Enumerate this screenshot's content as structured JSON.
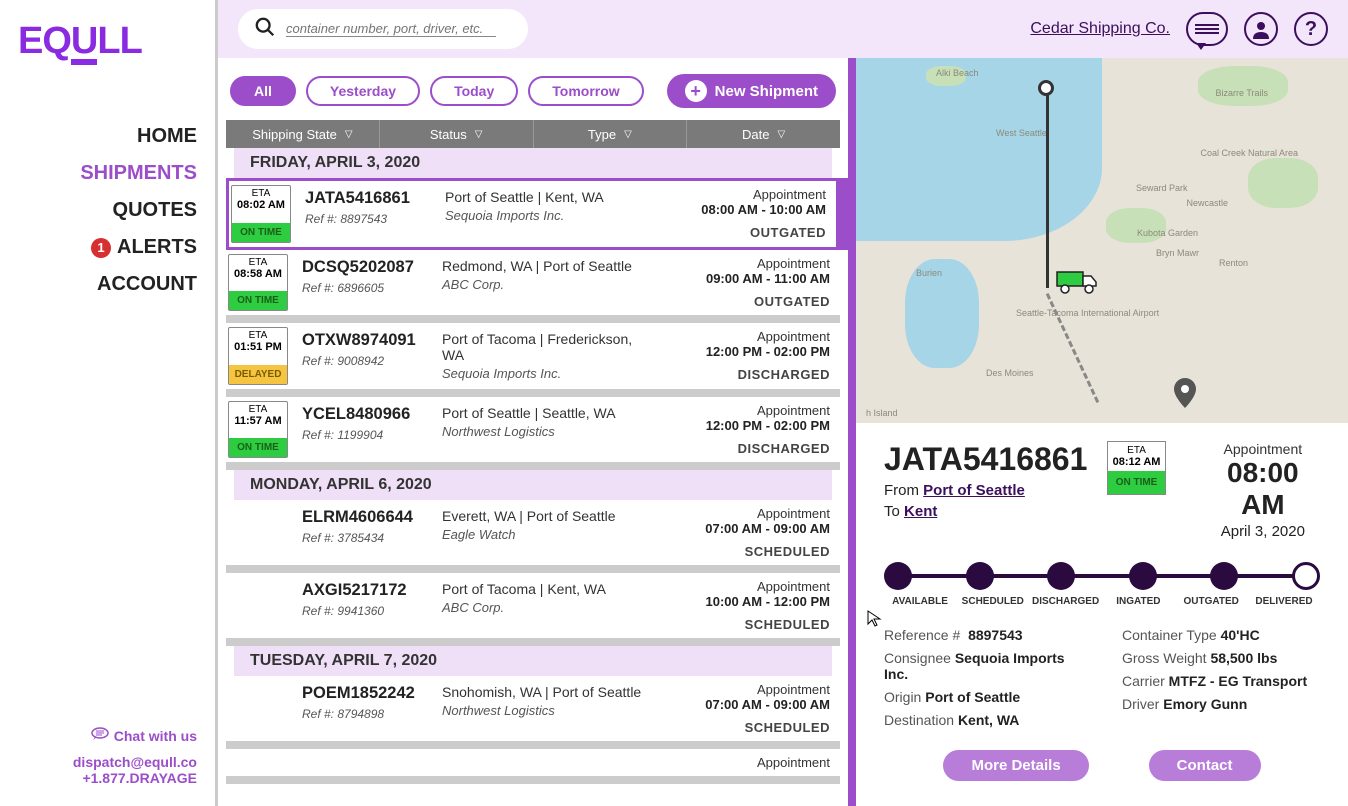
{
  "brand": "EQULL",
  "nav": {
    "home": "HOME",
    "shipments": "SHIPMENTS",
    "quotes": "QUOTES",
    "alerts": "ALERTS",
    "alerts_count": "1",
    "account": "ACCOUNT"
  },
  "footer": {
    "chat": "Chat with us",
    "email": "dispatch@equll.co",
    "phone": "+1.877.DRAYAGE"
  },
  "search": {
    "placeholder": "container number, port, driver, etc."
  },
  "company": "Cedar Shipping Co.",
  "filters": {
    "all": "All",
    "yesterday": "Yesterday",
    "today": "Today",
    "tomorrow": "Tomorrow",
    "new": "New Shipment"
  },
  "columns": {
    "state": "Shipping State",
    "status": "Status",
    "type": "Type",
    "date": "Date"
  },
  "dates": {
    "d1": "FRIDAY, APRIL 3, 2020",
    "d2": "MONDAY, APRIL 6, 2020",
    "d3": "TUESDAY, APRIL 7, 2020"
  },
  "labels": {
    "eta": "ETA",
    "appt": "Appointment",
    "ref_prefix": "Ref #: "
  },
  "rows": [
    {
      "eta": "08:02 AM",
      "status": "ON TIME",
      "status_class": "ontime",
      "id": "JATA5416861",
      "ref": "8897543",
      "route": "Port of Seattle | Kent, WA",
      "client": "Sequoia Imports Inc.",
      "appt": "08:00 AM - 10:00 AM",
      "state": "OUTGATED",
      "selected": true
    },
    {
      "eta": "08:58 AM",
      "status": "ON TIME",
      "status_class": "ontime",
      "id": "DCSQ5202087",
      "ref": "6896605",
      "route": "Redmond, WA | Port of Seattle",
      "client": "ABC Corp.",
      "appt": "09:00 AM - 11:00 AM",
      "state": "OUTGATED"
    },
    {
      "eta": "01:51 PM",
      "status": "DELAYED",
      "status_class": "delayed",
      "id": "OTXW8974091",
      "ref": "9008942",
      "route": "Port of Tacoma | Frederickson, WA",
      "client": "Sequoia Imports Inc.",
      "appt": "12:00 PM - 02:00 PM",
      "state": "DISCHARGED"
    },
    {
      "eta": "11:57 AM",
      "status": "ON TIME",
      "status_class": "ontime",
      "id": "YCEL8480966",
      "ref": "1199904",
      "route": "Port of Seattle | Seattle, WA",
      "client": "Northwest Logistics",
      "appt": "12:00 PM - 02:00 PM",
      "state": "DISCHARGED"
    }
  ],
  "rows2": [
    {
      "id": "ELRM4606644",
      "ref": "3785434",
      "route": "Everett, WA | Port of Seattle",
      "client": "Eagle Watch",
      "appt": "07:00 AM - 09:00 AM",
      "state": "SCHEDULED"
    },
    {
      "id": "AXGI5217172",
      "ref": "9941360",
      "route": "Port of Tacoma | Kent, WA",
      "client": "ABC Corp.",
      "appt": "10:00 AM - 12:00 PM",
      "state": "SCHEDULED"
    }
  ],
  "rows3": [
    {
      "id": "POEM1852242",
      "ref": "8794898",
      "route": "Snohomish, WA | Port of Seattle",
      "client": "Northwest Logistics",
      "appt": "07:00 AM - 09:00 AM",
      "state": "SCHEDULED"
    }
  ],
  "detail": {
    "id": "JATA5416861",
    "from_label": "From ",
    "from": "Port of Seattle",
    "to_label": "To ",
    "to": "Kent",
    "eta": "08:12 AM",
    "eta_status": "ON TIME",
    "appt_label": "Appointment",
    "appt_time": "08:00 AM",
    "appt_date": "April 3, 2020",
    "progress": {
      "available": "AVAILABLE",
      "scheduled": "SCHEDULED",
      "discharged": "DISCHARGED",
      "ingated": "INGATED",
      "outgated": "OUTGATED",
      "delivered": "DELIVERED"
    },
    "info": {
      "ref_l": "Reference #",
      "ref_v": "8897543",
      "cons_l": "Consignee",
      "cons_v": "Sequoia Imports Inc.",
      "orig_l": "Origin",
      "orig_v": "Port of Seattle",
      "dest_l": "Destination",
      "dest_v": "Kent, WA",
      "ctype_l": "Container Type",
      "ctype_v": "40'HC",
      "gw_l": "Gross Weight",
      "gw_v": "58,500 lbs",
      "car_l": "Carrier",
      "car_v": "MTFZ - EG Transport",
      "drv_l": "Driver",
      "drv_v": "Emory Gunn"
    },
    "buttons": {
      "more": "More Details",
      "contact": "Contact"
    }
  }
}
